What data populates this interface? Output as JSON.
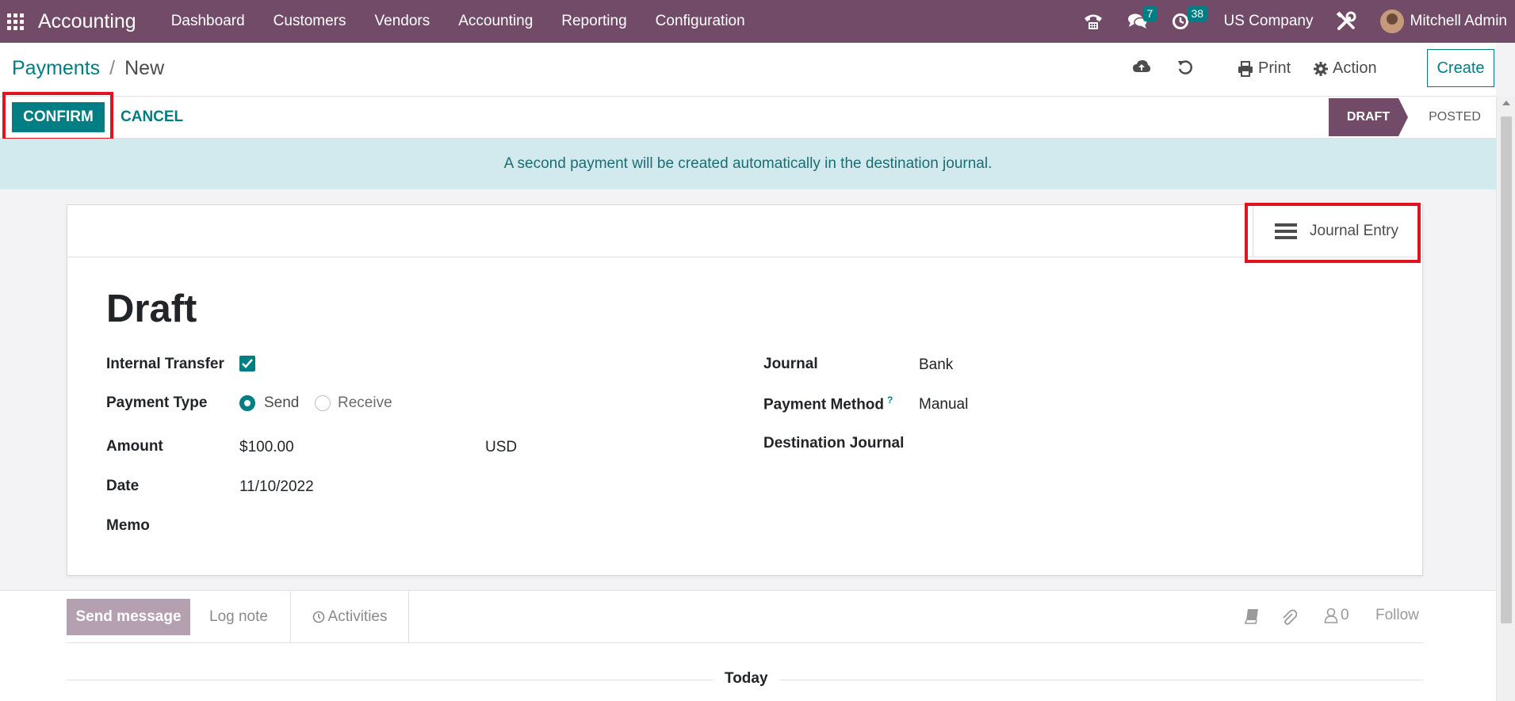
{
  "app": {
    "name": "Accounting"
  },
  "menu": [
    "Dashboard",
    "Customers",
    "Vendors",
    "Accounting",
    "Reporting",
    "Configuration"
  ],
  "navbar": {
    "messages_count": "7",
    "activities_count": "38",
    "company": "US Company",
    "user": "Mitchell Admin"
  },
  "breadcrumb": {
    "parent": "Payments",
    "separator": "/",
    "current": "New"
  },
  "control": {
    "print_label": "Print",
    "action_label": "Action",
    "create_label": "Create"
  },
  "status": {
    "confirm_label": "CONFIRM",
    "cancel_label": "CANCEL",
    "stages": [
      "DRAFT",
      "POSTED"
    ],
    "active_stage": "DRAFT"
  },
  "alert": {
    "text": "A second payment will be created automatically in the destination journal."
  },
  "form": {
    "smart_button": "Journal Entry",
    "title": "Draft",
    "left": {
      "internal_transfer_label": "Internal Transfer",
      "internal_transfer_checked": true,
      "payment_type_label": "Payment Type",
      "payment_type_options": [
        "Send",
        "Receive"
      ],
      "payment_type_selected": "Send",
      "amount_label": "Amount",
      "amount_value": "$100.00",
      "currency": "USD",
      "date_label": "Date",
      "date_value": "11/10/2022",
      "memo_label": "Memo"
    },
    "right": {
      "journal_label": "Journal",
      "journal_value": "Bank",
      "payment_method_label": "Payment Method",
      "payment_method_help": "?",
      "payment_method_value": "Manual",
      "destination_journal_label": "Destination Journal"
    }
  },
  "chatter": {
    "send_message": "Send message",
    "log_note": "Log note",
    "activities": "Activities",
    "followers_count": "0",
    "follow": "Follow",
    "today": "Today"
  },
  "colors": {
    "brand": "#714b67",
    "accent": "#017e84",
    "highlight": "#e0141e",
    "alert_bg": "#d2eaed"
  },
  "icons": [
    "apps-icon",
    "phone-icon",
    "chat-icon",
    "clock-icon",
    "tools-icon",
    "cloud-upload-icon",
    "undo-icon",
    "print-icon",
    "gear-icon",
    "list-icon",
    "check-icon",
    "book-icon",
    "paperclip-icon",
    "user-icon"
  ]
}
